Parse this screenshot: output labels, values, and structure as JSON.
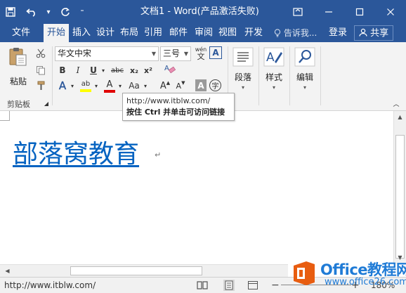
{
  "window": {
    "title": "文档1 - Word(产品激活失败)",
    "qat_more": "⁼"
  },
  "tabs": [
    {
      "label": "文件"
    },
    {
      "label": "开始"
    },
    {
      "label": "插入"
    },
    {
      "label": "设计"
    },
    {
      "label": "布局"
    },
    {
      "label": "引用"
    },
    {
      "label": "邮件"
    },
    {
      "label": "审阅"
    },
    {
      "label": "视图"
    },
    {
      "label": "开发"
    }
  ],
  "header": {
    "tell_me": "告诉我...",
    "login": "登录",
    "share": "共享"
  },
  "ribbon": {
    "paste_label": "粘贴",
    "clipboard_label": "剪贴板",
    "font_name": "华文中宋",
    "font_size": "三号",
    "wen_top": "wén",
    "wen_bottom": "文",
    "bold": "B",
    "italic": "I",
    "underline": "U",
    "strike": "abc",
    "subscript": "x₂",
    "superscript": "x²",
    "text_effect": "A",
    "highlight": "ab",
    "font_color": "A",
    "change_case": "Aa",
    "grow_font": "A",
    "shrink_font": "A",
    "char_shading": "A",
    "enclose_char": "字",
    "paragraph_label": "段落",
    "styles_label": "样式",
    "editing_label": "编辑"
  },
  "tooltip": {
    "url": "http://www.itblw.com/",
    "hint": "按住 Ctrl 并单击可访问链接"
  },
  "document": {
    "text": "部落窝教育",
    "para_mark": "↵"
  },
  "statusbar": {
    "url": "http://www.itblw.com/",
    "zoom": "180%"
  },
  "watermark": {
    "line1_a": "Office",
    "line1_b": "教程网",
    "line2": "www.office26.com"
  },
  "colors": {
    "word_blue": "#2b579a",
    "link_blue": "#0563c1",
    "ribbon_bg": "#f3f3f3",
    "highlight_yellow": "#ffff00",
    "font_color_red": "#e00000",
    "watermark_orange": "#e85d10"
  }
}
